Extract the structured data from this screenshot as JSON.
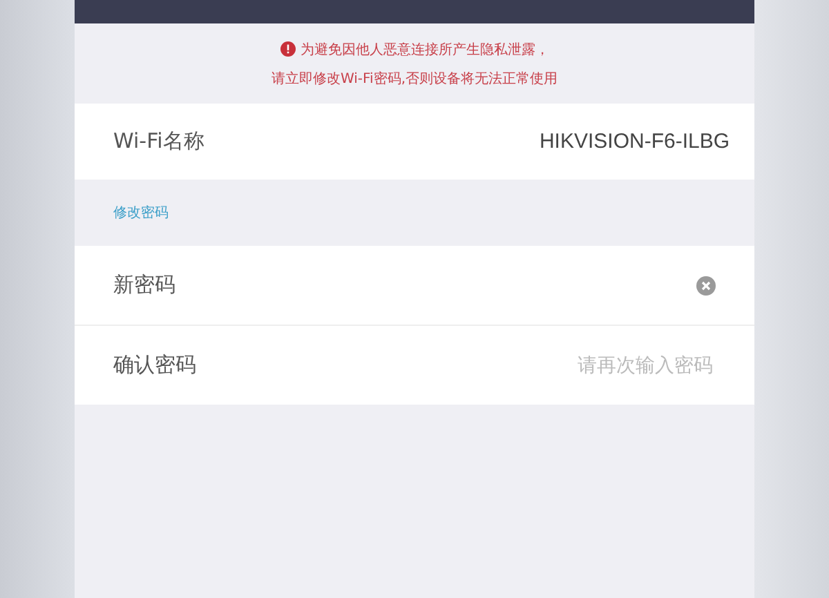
{
  "warning": {
    "lines": [
      "为避免因他人恶意连接所产生隐私泄露，",
      "请立即修改Wi-Fi密码,否则设备将无法正常使用"
    ]
  },
  "wifi_name": {
    "label": "Wi-Fi名称",
    "value": "HIKVISION-F6-ILBG"
  },
  "section_title": "修改密码",
  "fields": [
    {
      "label": "新密码",
      "clear_button": true
    },
    {
      "label": "确认密码",
      "placeholder": "请再次输入密码",
      "clear_button": false
    }
  ]
}
